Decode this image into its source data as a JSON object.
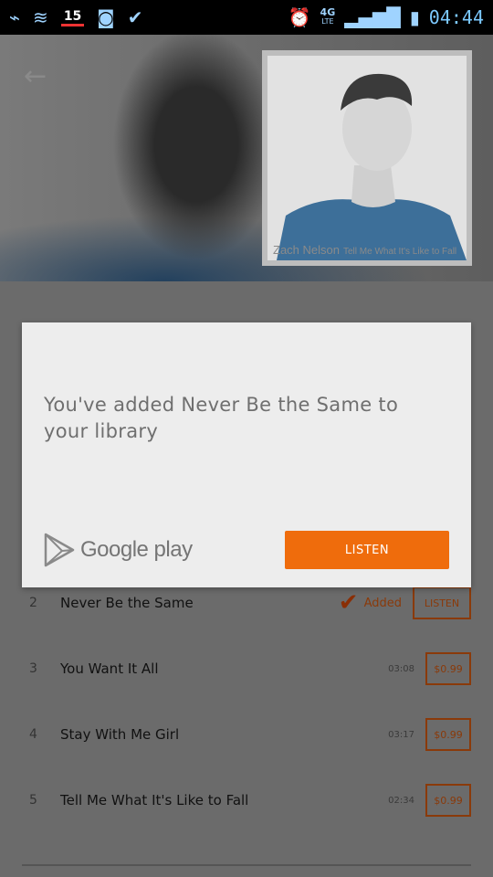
{
  "status_bar": {
    "battery_percent": "15",
    "network_label": "4G",
    "network_sub": "LTE",
    "time": "04:44"
  },
  "header": {
    "album_caption_artist": "Zach Nelson",
    "album_caption_title": "Tell Me What It's Like to Fall"
  },
  "dialog": {
    "message": "You've added Never Be the Same to your library",
    "brand": "Google play",
    "listen_label": "LISTEN"
  },
  "tracks": [
    {
      "num": "2",
      "title": "Never Be the Same",
      "status": "Added",
      "action": "LISTEN"
    },
    {
      "num": "3",
      "title": "You Want It All",
      "duration": "03:08",
      "price": "$0.99"
    },
    {
      "num": "4",
      "title": "Stay With Me Girl",
      "duration": "03:17",
      "price": "$0.99"
    },
    {
      "num": "5",
      "title": "Tell Me What It's Like to Fall",
      "duration": "02:34",
      "price": "$0.99"
    }
  ],
  "colors": {
    "accent": "#ef6c0c",
    "dialog_bg": "#ededed",
    "dim_overlay": "#6b6b6b"
  }
}
